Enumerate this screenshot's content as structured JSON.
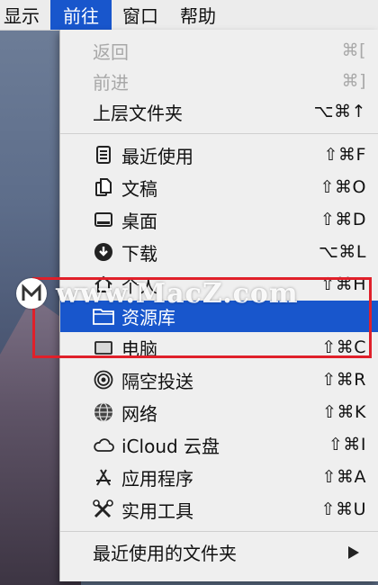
{
  "menubar": {
    "items": [
      "显示",
      "前往",
      "窗口",
      "帮助"
    ]
  },
  "menu": {
    "back": {
      "label": "返回",
      "shortcut": "⌘["
    },
    "forward": {
      "label": "前进",
      "shortcut": "⌘]"
    },
    "parent": {
      "label": "上层文件夹",
      "shortcut": "⌥⌘↑"
    },
    "recents": {
      "label": "最近使用",
      "shortcut": "⇧⌘F",
      "icon": "recents-icon"
    },
    "documents": {
      "label": "文稿",
      "shortcut": "⇧⌘O",
      "icon": "documents-icon"
    },
    "desktop": {
      "label": "桌面",
      "shortcut": "⇧⌘D",
      "icon": "desktop-icon"
    },
    "downloads": {
      "label": "下载",
      "shortcut": "⌥⌘L",
      "icon": "download-icon"
    },
    "home": {
      "label": "个人",
      "shortcut": "⇧⌘H",
      "icon": "home-icon"
    },
    "library": {
      "label": "资源库",
      "icon": "folder-icon"
    },
    "computer": {
      "label": "电脑",
      "shortcut": "⇧⌘C",
      "icon": "computer-icon"
    },
    "airdrop": {
      "label": "隔空投送",
      "shortcut": "⇧⌘R",
      "icon": "airdrop-icon"
    },
    "network": {
      "label": "网络",
      "shortcut": "⇧⌘K",
      "icon": "network-icon"
    },
    "icloud": {
      "label": "iCloud 云盘",
      "shortcut": "⇧⌘I",
      "icon": "cloud-icon"
    },
    "applications": {
      "label": "应用程序",
      "shortcut": "⇧⌘A",
      "icon": "applications-icon"
    },
    "utilities": {
      "label": "实用工具",
      "shortcut": "⇧⌘U",
      "icon": "utilities-icon"
    },
    "recent_folders": {
      "label": "最近使用的文件夹"
    }
  },
  "watermark": {
    "text": "www.MacZ.com"
  },
  "colors": {
    "accent": "#1856cc",
    "highlight_box": "#e0202a"
  }
}
